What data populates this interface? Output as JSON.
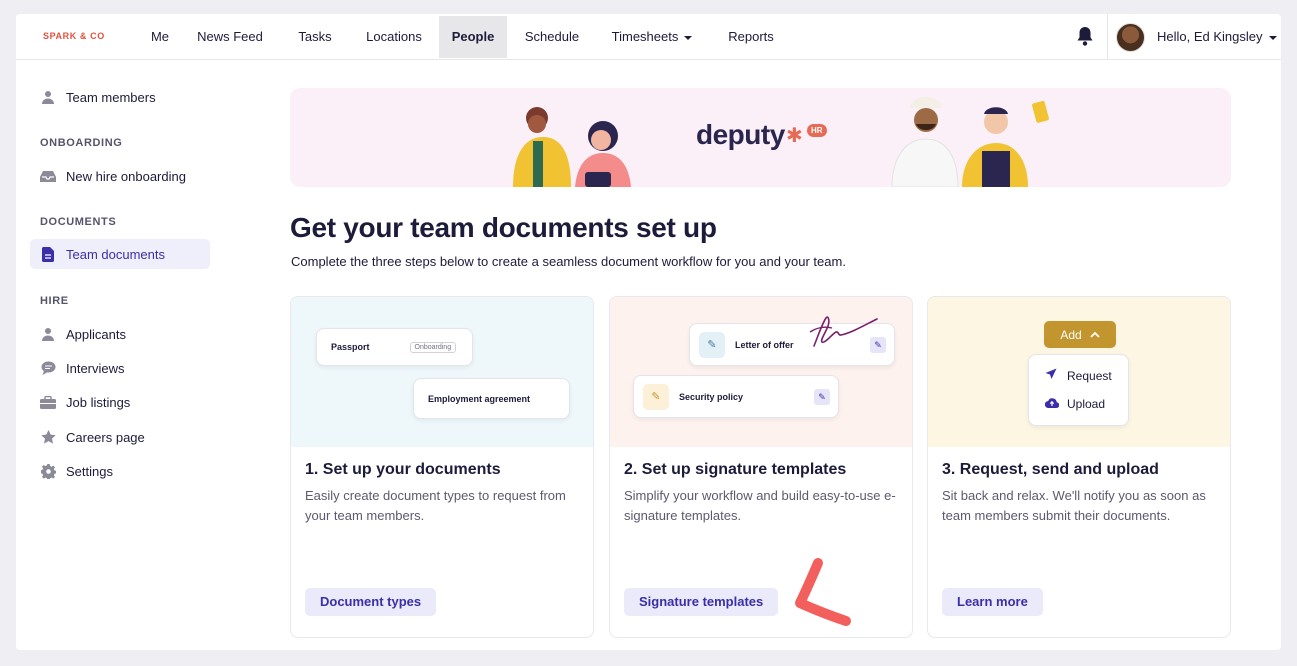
{
  "brand": "SPARK & CO",
  "nav": {
    "items": [
      "Me",
      "News Feed",
      "Tasks",
      "Locations",
      "People",
      "Schedule",
      "Timesheets",
      "Reports"
    ],
    "active": "People",
    "greeting": "Hello, Ed Kingsley"
  },
  "sidebar": {
    "team_members": "Team members",
    "onboarding_heading": "ONBOARDING",
    "new_hire": "New hire onboarding",
    "documents_heading": "DOCUMENTS",
    "team_documents": "Team documents",
    "hire_heading": "HIRE",
    "applicants": "Applicants",
    "interviews": "Interviews",
    "job_listings": "Job listings",
    "careers_page": "Careers page",
    "settings": "Settings"
  },
  "banner": {
    "logo": "deputy",
    "badge": "HR"
  },
  "main": {
    "title": "Get your team documents set up",
    "subtitle": "Complete the three steps below to create a seamless document workflow for you and your team."
  },
  "cards": [
    {
      "title": "1. Set up your documents",
      "desc": "Easily create document types to request from your team members.",
      "button": "Document types",
      "hero": {
        "doc1": "Passport",
        "doc1_tag": "Onboarding",
        "doc2": "Employment agreement"
      }
    },
    {
      "title": "2. Set up signature templates",
      "desc": "Simplify your workflow and build easy-to-use e-signature templates.",
      "button": "Signature templates",
      "hero": {
        "doc1": "Letter of offer",
        "doc2": "Security policy"
      }
    },
    {
      "title": "3. Request, send and upload",
      "desc": "Sit back and relax. We'll notify you as soon as team members submit their documents.",
      "button": "Learn more",
      "hero": {
        "add": "Add",
        "request": "Request",
        "upload": "Upload"
      }
    }
  ],
  "colors": {
    "accent": "#3a2fa8",
    "brand": "#e0523d",
    "add_button": "#c2952e",
    "annotation": "#f25f5c"
  }
}
